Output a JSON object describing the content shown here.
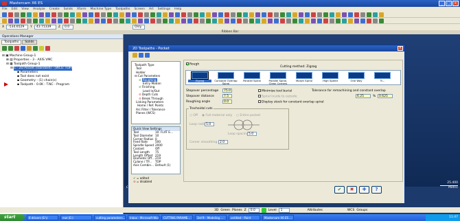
{
  "app": {
    "title": "Mastercam X6 ES"
  },
  "menu": [
    "File",
    "Edit",
    "View",
    "Analyze",
    "Create",
    "Solids",
    "Xform",
    "Machine Type",
    "Toolpaths",
    "Screen",
    "Art",
    "Settings",
    "Help"
  ],
  "coords": {
    "x": "-534.6529",
    "y": "43.71339",
    "z": "0.0",
    "view": "Only"
  },
  "ribbon": {
    "label": "Ribbon Bar"
  },
  "left_panel": {
    "header": "Operations Manager",
    "tabs": [
      "Toolpaths",
      "Solids"
    ],
    "tree": [
      "Machine Group-1",
      "Properties - 3 - AXIS VMC",
      "Toolpath Group-1",
      "1 - 2D Pocket (standard) - [WCS: TOP]",
      "Parameters",
      "Tool does not exist",
      "Geometry - (1) chain(s)",
      "Toolpath - 0.0K - T.NC - Program"
    ]
  },
  "dialog": {
    "title": "2D Toolpaths - Pocket",
    "tree": [
      "Toolpath Type",
      "Tool",
      "Holder",
      "Cut Parameters",
      "Roughing",
      "Entry Motion",
      "Finishing",
      "Lead In/Out",
      "Depth Cuts",
      "Break Through",
      "Linking Parameters",
      "Home / Ref. Points",
      "Arc Filter / Tolerance",
      "Planes (WCS)"
    ],
    "quick_view": {
      "header": "Quick View Settings",
      "rows": [
        [
          "Tool",
          "10. FLAT E..."
        ],
        [
          "Tool Diameter",
          "10"
        ],
        [
          "Corner Radius",
          "0"
        ],
        [
          "Feed Rate",
          "500"
        ],
        [
          "Spindle Speed",
          "2000"
        ],
        [
          "Coolant",
          "Off"
        ],
        [
          "Tool Length",
          "75"
        ],
        [
          "Length Offset",
          "219"
        ],
        [
          "Diameter Off...",
          "219"
        ],
        [
          "Cplane / TP...",
          "TOP"
        ],
        [
          "Axis Combin...",
          "Default (1)"
        ]
      ]
    },
    "legend": {
      "edited": "= edited",
      "disabled": "= disabled"
    },
    "roughing": {
      "checkbox_label": "Rough",
      "cutting_method_label": "Cutting method:",
      "cutting_method_value": "Zigzag",
      "methods": [
        "Zigzag",
        "Constant Overlap Spiral",
        "Parallel Spiral",
        "Parallel Spiral, Clean Corners",
        "Morph Spiral",
        "High Speed",
        "One Way",
        "Tr..."
      ],
      "stepover_pct_label": "Stepover percentage",
      "stepover_pct": "75.0",
      "stepover_dist_label": "Stepover distance",
      "stepover_dist": "7.5",
      "angle_label": "Roughing angle",
      "angle": "0.0",
      "minimize_label": "Minimize tool burial",
      "spiral_label": "Spiral inside to outside",
      "display_stock_label": "Display stock for constant overlap spiral",
      "tolerance_label": "Tolerance for remachining and constant overlap",
      "tol_pct": "6.25",
      "tol_val": "0.625"
    },
    "trochoidal": {
      "title": "Trochoidal cuts",
      "opt_off": "Off",
      "opt_full": "Full material only",
      "opt_entire": "Entire pocket",
      "loop_radius_label": "Loop radius",
      "loop_radius": "5.0",
      "loop_spacing_label": "Loop spacing",
      "loop_spacing": "5.0",
      "smoothing_label": "Corner smoothing radius",
      "smoothing": "2.0"
    },
    "buttons": {
      "ok": "✔",
      "cancel": "✖",
      "add": "✚",
      "help": "?"
    }
  },
  "viewport": {
    "status": "Gview:TOP  WCS:TOP  T/Cplane:TOP",
    "scale_value": "25.400",
    "scale_unit": "Metric"
  },
  "bottombar": {
    "mode": "3D",
    "group": "Green",
    "plane": "Planes",
    "z_label": "Z",
    "z_value": "0.0",
    "level_label": "Level",
    "level": "1",
    "attributes": "Attributes",
    "wcs": "WCS",
    "groups": "Groups"
  },
  "taskbar": {
    "start": "start",
    "tasks": [
      "6 drivers (E:\\)",
      "mol (E:)",
      "cutting parameters...",
      "Inbox - Microsoft Word",
      "CUTTING PARAME...",
      "3rd ft - Modeling ...",
      "untitled - Paint",
      "Mastercam X6 ES ..."
    ],
    "time": "11:47"
  },
  "colors": {
    "accent": "#316ac5",
    "title": "#1946a0",
    "viewport": "#1f3f76"
  }
}
